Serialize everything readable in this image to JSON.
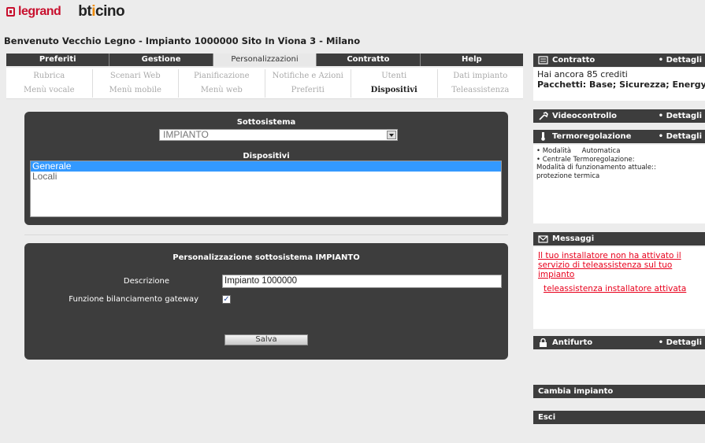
{
  "logos": {
    "legrand": "legrand",
    "bticino": "bticino"
  },
  "welcome": "Benvenuto Vecchio Legno - Impianto 1000000 Sito In Viona 3 - Milano",
  "tabs": [
    "Preferiti",
    "Gestione",
    "Personalizzazioni",
    "Contratto",
    "Help"
  ],
  "active_tab": "Personalizzazioni",
  "subnav": {
    "row1": [
      "Rubrica",
      "Scenari Web",
      "Pianificazione",
      "Notifiche e Azioni",
      "Utenti",
      "Dati impianto"
    ],
    "row2": [
      "Menù vocale",
      "Menù mobile",
      "Menù web",
      "Preferiti",
      "Dispositivi",
      "Teleassistenza"
    ],
    "current": "Dispositivi"
  },
  "panel1": {
    "sottosistema_title": "Sottosistema",
    "select_value": "IMPIANTO",
    "dispositivi_title": "Dispositivi",
    "items": [
      "Generale",
      "Locali"
    ],
    "selected": "Generale"
  },
  "panel2": {
    "title": "Personalizzazione sottosistema IMPIANTO",
    "descrizione_label": "Descrizione",
    "descrizione_value": "Impianto 1000000",
    "gateway_label": "Funzione bilanciamento gateway",
    "gateway_checked": "✓",
    "save": "Salva"
  },
  "sidebar": {
    "contratto": {
      "title": "Contratto",
      "details": "• Dettagli",
      "icon": "document-icon",
      "line1": "Hai ancora 85 crediti",
      "line2": "Pacchetti: Base; Sicurezza; Energy;"
    },
    "videocontrollo": {
      "title": "Videocontrollo",
      "details": "• Dettagli",
      "icon": "wrench-icon"
    },
    "termoregolazione": {
      "title": "Termoregolazione",
      "details": "• Dettagli",
      "icon": "thermometer-icon",
      "line1": "• Modalità     Automatica",
      "line2": "• Centrale Termoregolazione:",
      "line3": "Modalità di funzionamento attuale::",
      "line4": "protezione termica"
    },
    "messaggi": {
      "title": "Messaggi",
      "icon": "envelope-icon",
      "msg1": "Il tuo installatore non ha attivato il servizio di teleassistenza sul tuo impianto",
      "msg2": "teleassistenza installatore attivata"
    },
    "antifurto": {
      "title": "Antifurto",
      "details": "• Dettagli",
      "icon": "lock-icon"
    },
    "cambia": "Cambia impianto",
    "esci": "Esci"
  }
}
